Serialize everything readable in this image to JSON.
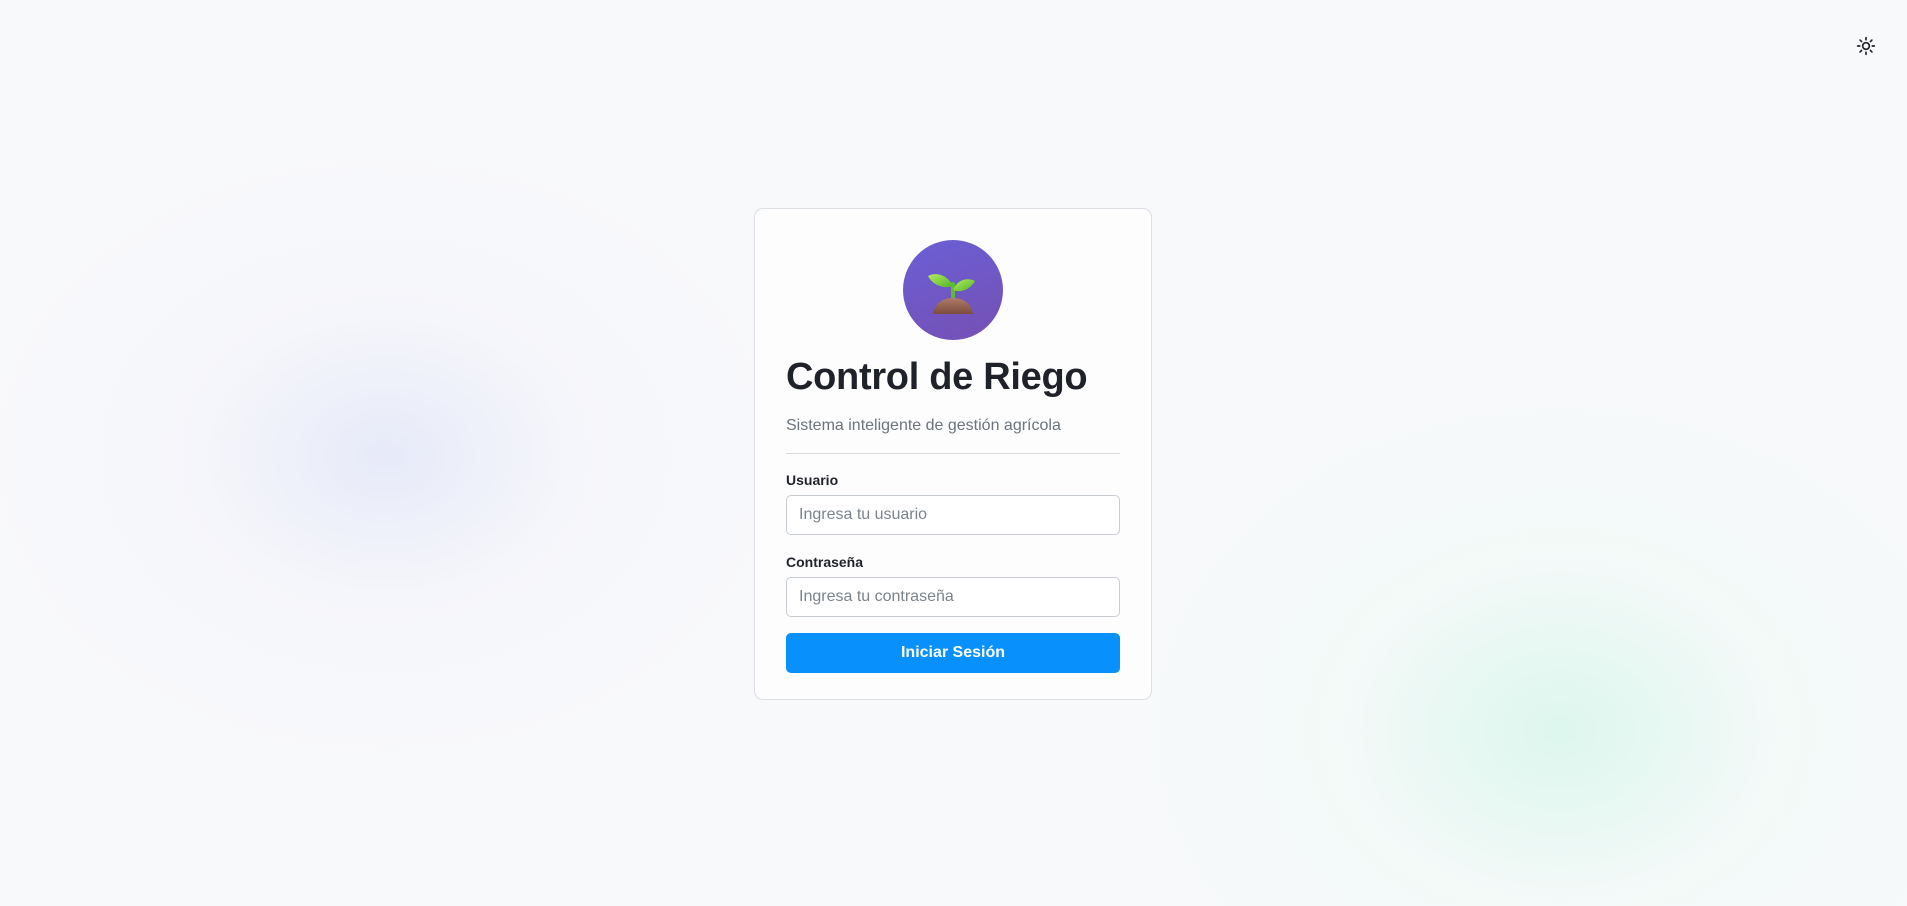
{
  "header": {
    "theme_toggle_icon": "sun-icon"
  },
  "login": {
    "logo_icon": "seedling-icon",
    "title": "Control de Riego",
    "subtitle": "Sistema inteligente de gestión agrícola",
    "username": {
      "label": "Usuario",
      "placeholder": "Ingresa tu usuario",
      "value": ""
    },
    "password": {
      "label": "Contraseña",
      "placeholder": "Ingresa tu contraseña",
      "value": ""
    },
    "submit_label": "Iniciar Sesión"
  },
  "colors": {
    "primary_button": "#0891fd",
    "logo_gradient_start": "#6a5fd6",
    "logo_gradient_end": "#7650b3",
    "text_primary": "#1f2329",
    "text_muted": "#6b737c"
  }
}
